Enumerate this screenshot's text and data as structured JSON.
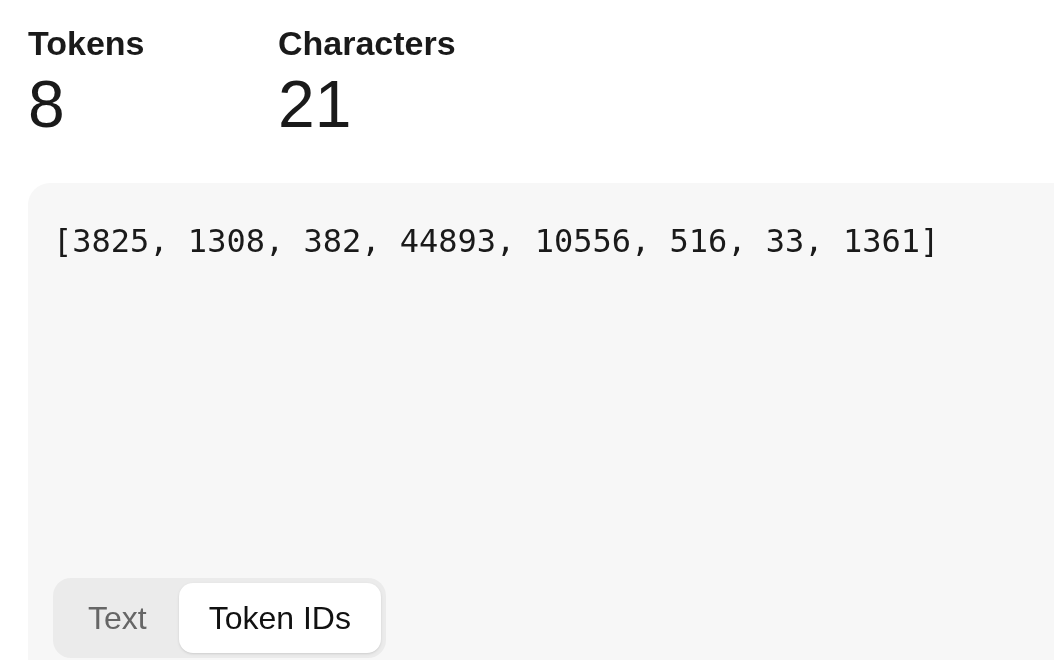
{
  "stats": [
    {
      "label": "Tokens",
      "value": "8"
    },
    {
      "label": "Characters",
      "value": "21"
    }
  ],
  "output": {
    "text": "[3825, 1308, 382, 44893, 10556, 516, 33, 1361]"
  },
  "view_toggle": [
    {
      "label": "Text",
      "selected": false
    },
    {
      "label": "Token IDs",
      "selected": true
    }
  ]
}
